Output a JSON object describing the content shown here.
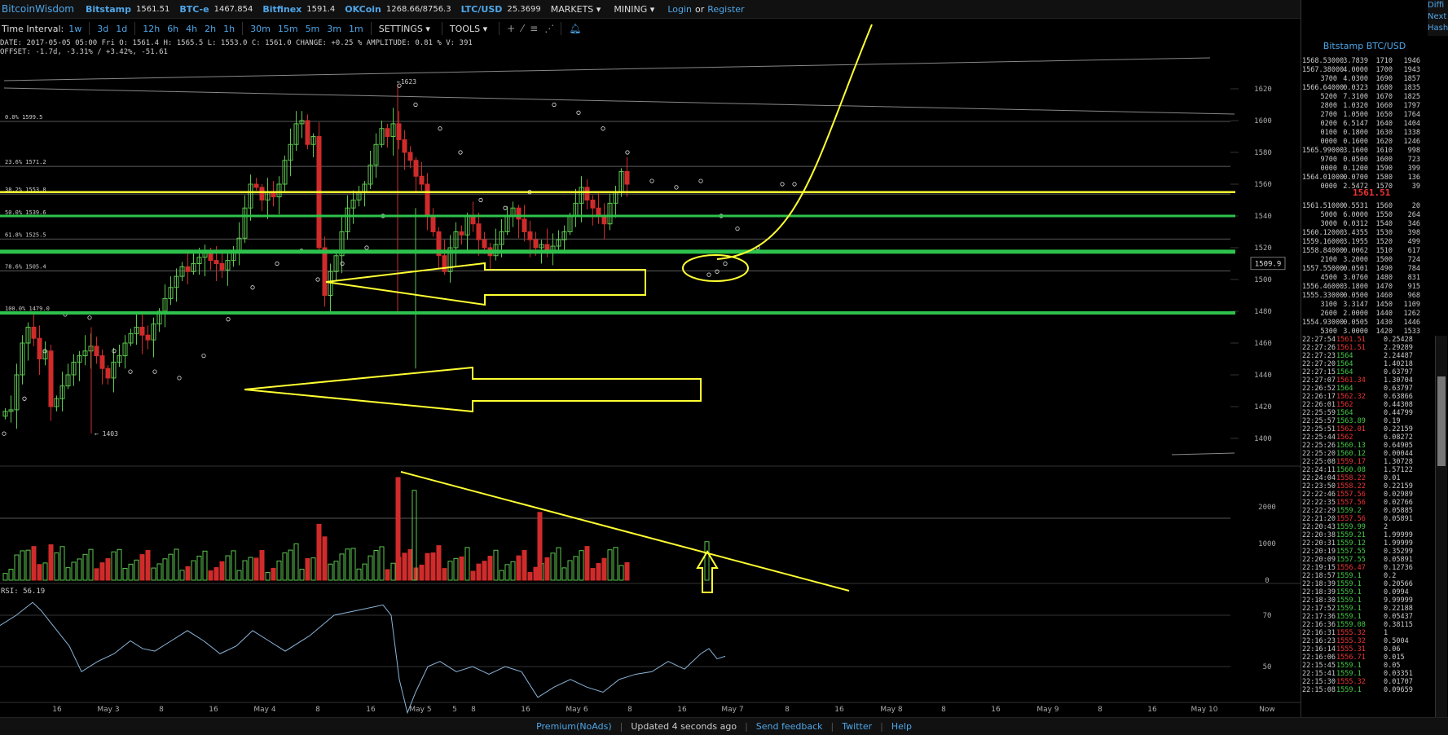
{
  "topbar": {
    "brand": "BitcoinWisdom",
    "tickers": [
      {
        "exchange": "Bitstamp",
        "price": "1561.51"
      },
      {
        "exchange": "BTC-e",
        "price": "1467.854"
      },
      {
        "exchange": "Bitfinex",
        "price": "1591.4"
      },
      {
        "exchange": "OKCoin",
        "price": "1268.66/8756.3"
      },
      {
        "exchange": "LTC/USD",
        "price": "25.3699"
      }
    ],
    "markets": "MARKETS",
    "mining": "MINING",
    "login": "Login",
    "or": "or",
    "register": "Register"
  },
  "toolbar": {
    "time_interval_label": "Time Interval:",
    "intervals": [
      "1w",
      "3d",
      "1d",
      "12h",
      "6h",
      "4h",
      "2h",
      "1h",
      "30m",
      "15m",
      "5m",
      "3m",
      "1m"
    ],
    "settings": "SETTINGS",
    "tools": "TOOLS"
  },
  "ohlc": {
    "line1": "DATE: 2017-05-05 05:00 Fri   O: 1561.4   H: 1565.5   L: 1553.0   C: 1561.0   CHANGE: +0.25 %   AMPLITUDE: 0.81 %   V: 391",
    "line2": "OFFSET: -1.7d, -3.31% / +3.42%, -51.61"
  },
  "diff": [
    "Diffi",
    "Next",
    "Hash"
  ],
  "orderbook": {
    "title": "Bitstamp BTC/USD",
    "mid_price": "1561.51",
    "asks": [
      [
        "1568.53000",
        "3.7839",
        "1710",
        "1946"
      ],
      [
        "1567.38000",
        "4.0000",
        "1700",
        "1943"
      ],
      [
        "3700",
        "4.0300",
        "1690",
        "1857"
      ],
      [
        "1566.64000",
        "0.0323",
        "1680",
        "1835"
      ],
      [
        "5200",
        "7.3100",
        "1670",
        "1825"
      ],
      [
        "2800",
        "1.0320",
        "1660",
        "1797"
      ],
      [
        "2700",
        "1.0500",
        "1650",
        "1764"
      ],
      [
        "0200",
        "6.5147",
        "1640",
        "1404"
      ],
      [
        "0100",
        "0.1800",
        "1630",
        "1338"
      ],
      [
        "0000",
        "0.1600",
        "1620",
        "1246"
      ],
      [
        "1565.99000",
        "3.1600",
        "1610",
        "998"
      ],
      [
        "9700",
        "0.0500",
        "1600",
        "723"
      ],
      [
        "0000",
        "0.1200",
        "1590",
        "399"
      ],
      [
        "1564.01000",
        "0.0700",
        "1580",
        "136"
      ],
      [
        "0000",
        "2.5472",
        "1570",
        "39"
      ]
    ],
    "bids": [
      [
        "1561.51000",
        "0.5531",
        "1560",
        "20"
      ],
      [
        "5000",
        "6.0000",
        "1550",
        "264"
      ],
      [
        "3000",
        "0.0312",
        "1540",
        "346"
      ],
      [
        "1560.12000",
        "3.4355",
        "1530",
        "398"
      ],
      [
        "1559.16000",
        "3.1955",
        "1520",
        "499"
      ],
      [
        "1558.84000",
        "0.0062",
        "1510",
        "617"
      ],
      [
        "2100",
        "3.2000",
        "1500",
        "724"
      ],
      [
        "1557.55000",
        "0.0501",
        "1490",
        "784"
      ],
      [
        "4500",
        "3.0760",
        "1480",
        "831"
      ],
      [
        "1556.46000",
        "3.1800",
        "1470",
        "915"
      ],
      [
        "1555.33000",
        "0.0500",
        "1460",
        "968"
      ],
      [
        "3100",
        "3.3147",
        "1450",
        "1109"
      ],
      [
        "2600",
        "2.0000",
        "1440",
        "1262"
      ],
      [
        "1554.93000",
        "0.0505",
        "1430",
        "1446"
      ],
      [
        "5300",
        "3.0000",
        "1420",
        "1533"
      ]
    ],
    "trades": [
      [
        "22:27:54",
        "1561.51",
        "r",
        "0.25428"
      ],
      [
        "22:27:26",
        "1561.51",
        "r",
        "2.29289"
      ],
      [
        "22:27:23",
        "1564",
        "g",
        "2.24487"
      ],
      [
        "22:27:20",
        "1564",
        "g",
        "1.40218"
      ],
      [
        "22:27:15",
        "1564",
        "g",
        "0.63797"
      ],
      [
        "22:27:07",
        "1561.34",
        "r",
        "1.30704"
      ],
      [
        "22:26:52",
        "1564",
        "g",
        "0.63797"
      ],
      [
        "22:26:17",
        "1562.32",
        "r",
        "0.63866"
      ],
      [
        "22:26:01",
        "1562",
        "r",
        "0.44308"
      ],
      [
        "22:25:59",
        "1564",
        "g",
        "0.44799"
      ],
      [
        "22:25:57",
        "1563.89",
        "g",
        "0.19"
      ],
      [
        "22:25:51",
        "1562.01",
        "r",
        "0.22159"
      ],
      [
        "22:25:44",
        "1562",
        "r",
        "6.08272"
      ],
      [
        "22:25:26",
        "1560.13",
        "g",
        "0.64905"
      ],
      [
        "22:25:20",
        "1560.12",
        "g",
        "0.00044"
      ],
      [
        "22:25:08",
        "1559.17",
        "r",
        "1.30728"
      ],
      [
        "22:24:11",
        "1560.08",
        "g",
        "1.57122"
      ],
      [
        "22:24:04",
        "1558.22",
        "r",
        "0.01"
      ],
      [
        "22:23:50",
        "1558.22",
        "r",
        "0.22159"
      ],
      [
        "22:22:46",
        "1557.56",
        "r",
        "0.02989"
      ],
      [
        "22:22:35",
        "1557.56",
        "r",
        "0.02766"
      ],
      [
        "22:22:29",
        "1559.2",
        "g",
        "0.05885"
      ],
      [
        "22:21:20",
        "1557.56",
        "r",
        "0.05891"
      ],
      [
        "22:20:43",
        "1559.99",
        "g",
        "2"
      ],
      [
        "22:20:38",
        "1559.21",
        "g",
        "1.99999"
      ],
      [
        "22:20:31",
        "1559.12",
        "g",
        "1.99999"
      ],
      [
        "22:20:19",
        "1557.55",
        "g",
        "0.35299"
      ],
      [
        "22:20:09",
        "1557.55",
        "g",
        "0.05891"
      ],
      [
        "22:19:15",
        "1556.47",
        "r",
        "0.12736"
      ],
      [
        "22:18:57",
        "1559.1",
        "g",
        "0.2"
      ],
      [
        "22:18:39",
        "1559.1",
        "g",
        "0.20566"
      ],
      [
        "22:18:39",
        "1559.1",
        "g",
        "0.0994"
      ],
      [
        "22:18:30",
        "1559.1",
        "g",
        "9.99999"
      ],
      [
        "22:17:52",
        "1559.1",
        "g",
        "0.22188"
      ],
      [
        "22:17:36",
        "1559.1",
        "g",
        "0.05437"
      ],
      [
        "22:16:36",
        "1559.08",
        "g",
        "0.38115"
      ],
      [
        "22:16:31",
        "1555.32",
        "r",
        "1"
      ],
      [
        "22:16:23",
        "1555.32",
        "r",
        "0.5004"
      ],
      [
        "22:16:14",
        "1555.31",
        "r",
        "0.06"
      ],
      [
        "22:16:06",
        "1556.71",
        "r",
        "0.015"
      ],
      [
        "22:15:45",
        "1559.1",
        "g",
        "0.05"
      ],
      [
        "22:15:41",
        "1559.1",
        "g",
        "0.03351"
      ],
      [
        "22:15:30",
        "1555.32",
        "r",
        "0.01707"
      ],
      [
        "22:15:08",
        "1559.1",
        "g",
        "0.09659"
      ]
    ]
  },
  "chart": {
    "price_axis": [
      "1620",
      "1600",
      "1580",
      "1560",
      "1540",
      "1520",
      "1500",
      "1480",
      "1460",
      "1440",
      "1420",
      "1400"
    ],
    "volume_axis": [
      "2000",
      "1000",
      "0"
    ],
    "rsi_axis": [
      "70",
      "50"
    ],
    "time_axis": [
      "16",
      "May 3",
      "8",
      "16",
      "May 4",
      "8",
      "16",
      "May 5",
      "5",
      "8",
      "16",
      "May 6",
      "8",
      "16",
      "May 7",
      "8",
      "16",
      "May 8",
      "8",
      "16",
      "May 9",
      "8",
      "16",
      "May 10",
      "Now"
    ],
    "fib_labels": [
      "0.0% 1599.5",
      "23.6% 1571.2",
      "38.2% 1553.8",
      "50.0% 1539.6",
      "61.8% 1525.5",
      "78.6% 1505.4",
      "100.0% 1479.0"
    ],
    "high_label": "1623",
    "low_label": "1403",
    "price_tag": "1509.9",
    "rsi_label": "RSI: 56.19",
    "colors": {
      "up": "#5cc84f",
      "down": "#d02b2b",
      "annotation": "#ffff33",
      "support": "#2ec24d"
    }
  },
  "footer": {
    "links": [
      "Premium(NoAds)",
      "Updated 4 seconds ago",
      "Send feedback",
      "Twitter",
      "Help"
    ]
  }
}
